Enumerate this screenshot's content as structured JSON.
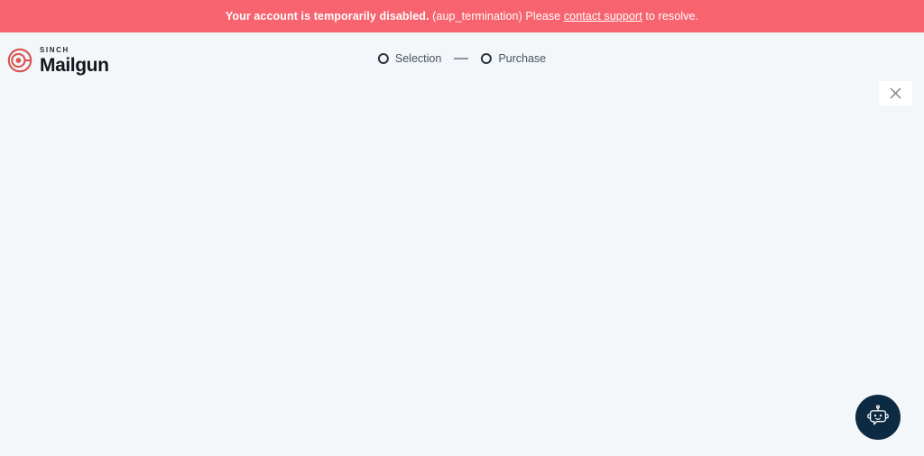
{
  "banner": {
    "message_bold": "Your account is temporarily disabled.",
    "message_code": "(aup_termination) Please",
    "link_label": "contact support",
    "message_tail": "to resolve.",
    "background_color": "#f7636e",
    "text_color": "#ffffff"
  },
  "header": {
    "logo": {
      "brand_prefix": "SINCH",
      "brand_name": "Mailgun",
      "mark_color": "#d9534f"
    },
    "stepper": {
      "steps": [
        {
          "label": "Selection",
          "state": "inactive"
        },
        {
          "label": "Purchase",
          "state": "inactive"
        }
      ],
      "separator": "—"
    },
    "close_button": {
      "icon": "close-icon",
      "label": "×"
    },
    "background_color": "#f3f7fa"
  },
  "main": {
    "background_color": "#f3f7fa",
    "content": ""
  },
  "chat_widget": {
    "icon": "robot-chat-icon",
    "background_color": "#0d2a43",
    "icon_color": "#ffffff"
  }
}
